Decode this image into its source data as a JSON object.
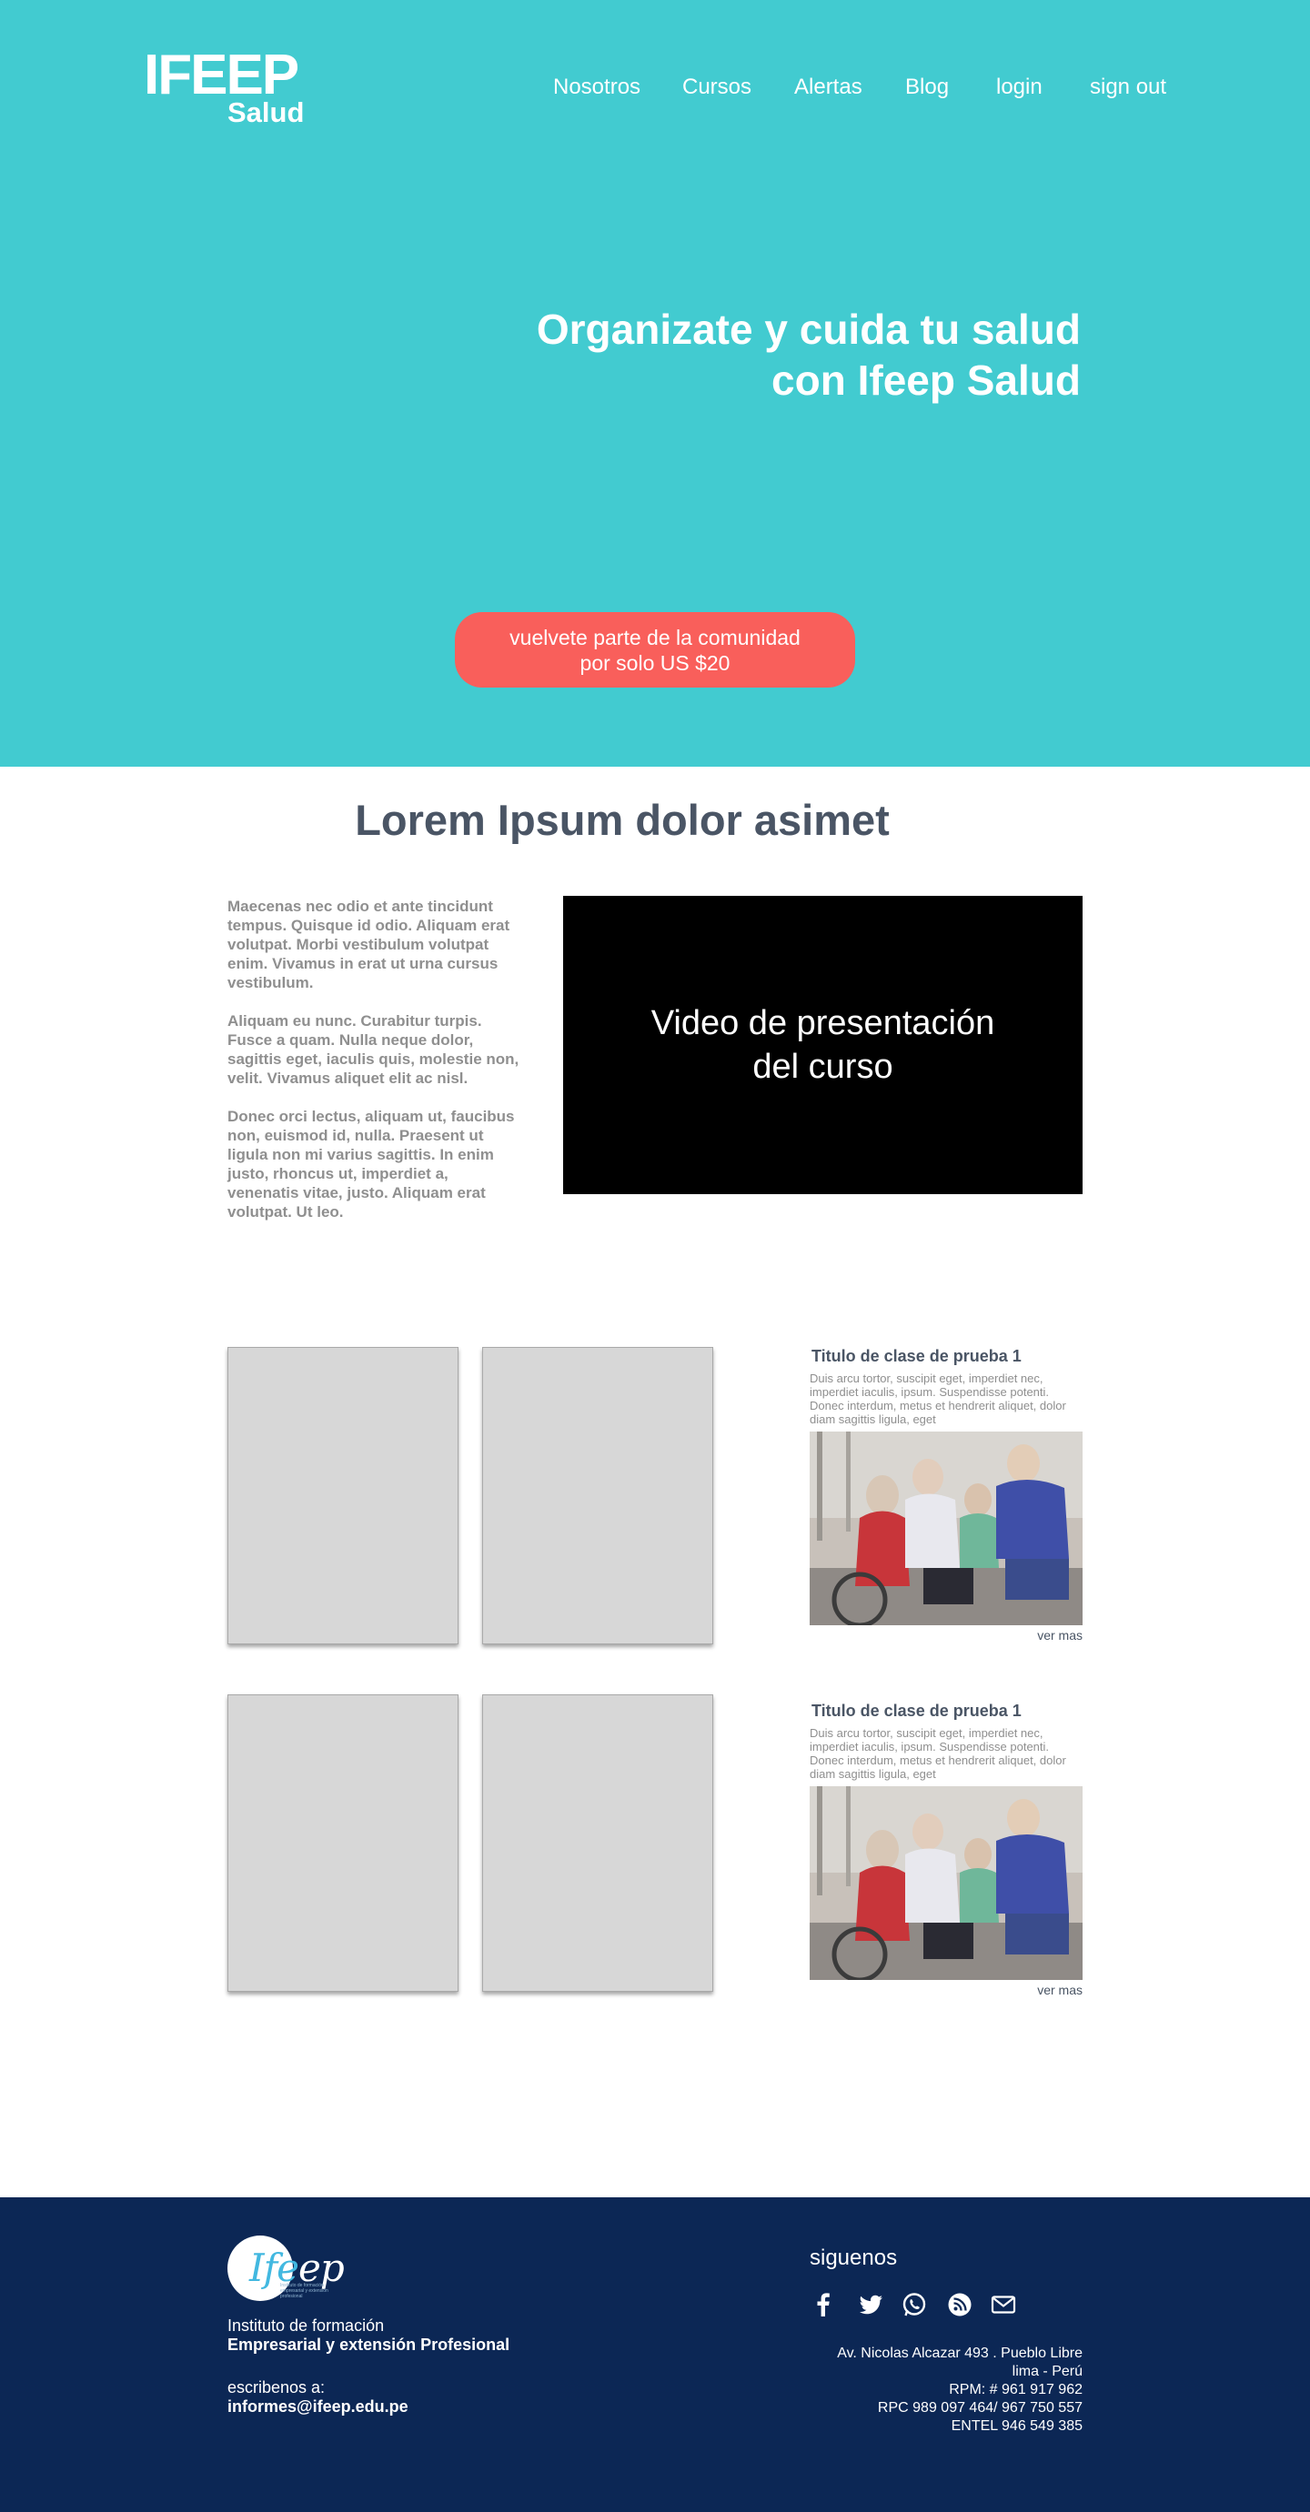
{
  "brand": {
    "logo_main": "IFEEP",
    "logo_sub": "Salud"
  },
  "nav": [
    {
      "label": "Nosotros"
    },
    {
      "label": "Cursos"
    },
    {
      "label": "Alertas"
    },
    {
      "label": "Blog"
    },
    {
      "label": "login"
    },
    {
      "label": "sign out"
    }
  ],
  "hero": {
    "title": "Organizate y  cuida tu salud\ncon Ifeep Salud",
    "cta": "vuelvete parte de la comunidad\npor solo US $20"
  },
  "section": {
    "title": "Lorem Ipsum dolor asimet",
    "paragraphs": [
      "Maecenas nec odio et ante tincidunt tempus. Quisque id odio. Aliquam erat volutpat. Morbi vestibulum volutpat enim. Vivamus in erat ut urna cursus vestibulum.",
      "Aliquam eu nunc. Curabitur turpis. Fusce a quam. Nulla neque dolor, sagittis eget, iaculis quis, molestie non, velit. Vivamus aliquet elit ac nisl.",
      "Donec orci lectus, aliquam ut, faucibus non, euismod id, nulla. Praesent ut ligula non mi varius sagittis. In enim justo, rhoncus ut, imperdiet a, venenatis vitae, justo. Aliquam erat volutpat. Ut leo."
    ],
    "video_label": "Video de presentación\ndel curso"
  },
  "posts": [
    {
      "title": "Titulo de clase de prueba 1",
      "body": "Duis arcu tortor, suscipit eget, imperdiet nec, imperdiet iaculis, ipsum. Suspendisse potenti. Donec interdum, metus et hendrerit aliquet, dolor diam sagittis ligula, eget",
      "more": "ver mas"
    },
    {
      "title": "Titulo de clase de prueba 1",
      "body": "Duis arcu tortor, suscipit eget, imperdiet nec, imperdiet iaculis, ipsum. Suspendisse potenti. Donec interdum, metus et hendrerit aliquet, dolor diam sagittis ligula, eget",
      "more": "ver mas"
    }
  ],
  "footer": {
    "logo_text_a": "Ife",
    "logo_text_b": "ep",
    "logo_small": "Instituto de formación empresarial y extensión profesional",
    "institute_line1": "Instituto de formación",
    "institute_line2": "Empresarial y extensión Profesional",
    "write_label": "escribenos a:",
    "email": "informes@ifeep.edu.pe",
    "follow": "siguenos",
    "social_icons": [
      "facebook-icon",
      "twitter-icon",
      "whatsapp-icon",
      "rss-icon",
      "mail-icon"
    ],
    "address": [
      "Av. Nicolas Alcazar 493 . Pueblo Libre",
      "lima - Perú",
      "RPM: # 961 917 962",
      "RPC 989 097 464/ 967 750 557",
      "ENTEL 946 549 385"
    ]
  },
  "colors": {
    "hero_bg": "#42cbd0",
    "cta_bg": "#f95f5b",
    "footer_bg": "#0c2755",
    "heading": "#4a5565",
    "muted_text": "#8f8f8f"
  }
}
